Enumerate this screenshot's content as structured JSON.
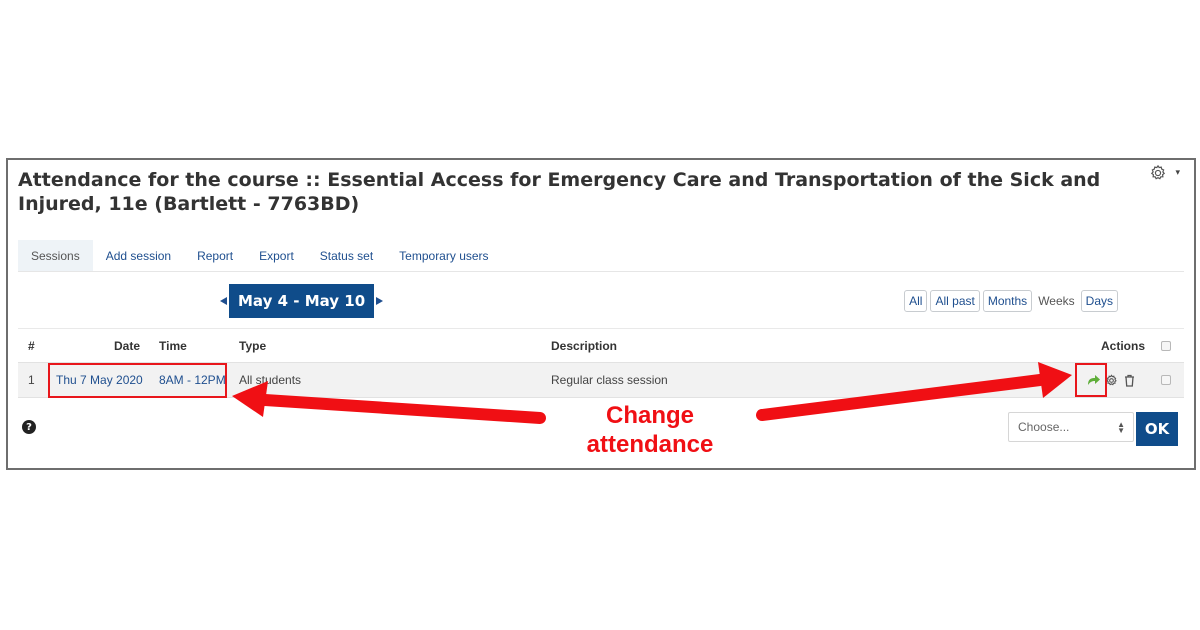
{
  "page": {
    "title": "Attendance for the course :: Essential Access for Emergency Care and Transportation of the Sick and Injured, 11e (Bartlett - 7763BD)",
    "settings_icon": "gear-icon",
    "settings_caret": "▾"
  },
  "tabs": [
    {
      "label": "Sessions",
      "active": true
    },
    {
      "label": "Add session",
      "active": false
    },
    {
      "label": "Report",
      "active": false
    },
    {
      "label": "Export",
      "active": false
    },
    {
      "label": "Status set",
      "active": false
    },
    {
      "label": "Temporary users",
      "active": false
    }
  ],
  "week_nav": {
    "label": "May 4 - May 10",
    "prev_icon": "triangle-left-icon",
    "next_icon": "triangle-right-icon"
  },
  "view_filters": {
    "all": "All",
    "all_past": "All past",
    "months": "Months",
    "weeks": "Weeks",
    "days": "Days",
    "current": "Weeks"
  },
  "table": {
    "headers": {
      "number": "#",
      "date": "Date",
      "time": "Time",
      "type": "Type",
      "description": "Description",
      "actions": "Actions"
    },
    "rows": [
      {
        "number": "1",
        "date": "Thu 7 May 2020",
        "time": "8AM - 12PM",
        "type": "All students",
        "description": "Regular class session",
        "actions": [
          "take-attendance-icon",
          "gear-icon",
          "trash-icon"
        ]
      }
    ]
  },
  "footer": {
    "help_icon": "?",
    "select_placeholder": "Choose...",
    "ok_label": "OK"
  },
  "annotation": {
    "line1": "Change",
    "line2": "attendance",
    "color": "#f00f14"
  },
  "colors": {
    "brand_blue": "#0f4c8a",
    "link_blue": "#1f4f8f",
    "action_green": "#5fae3a"
  }
}
